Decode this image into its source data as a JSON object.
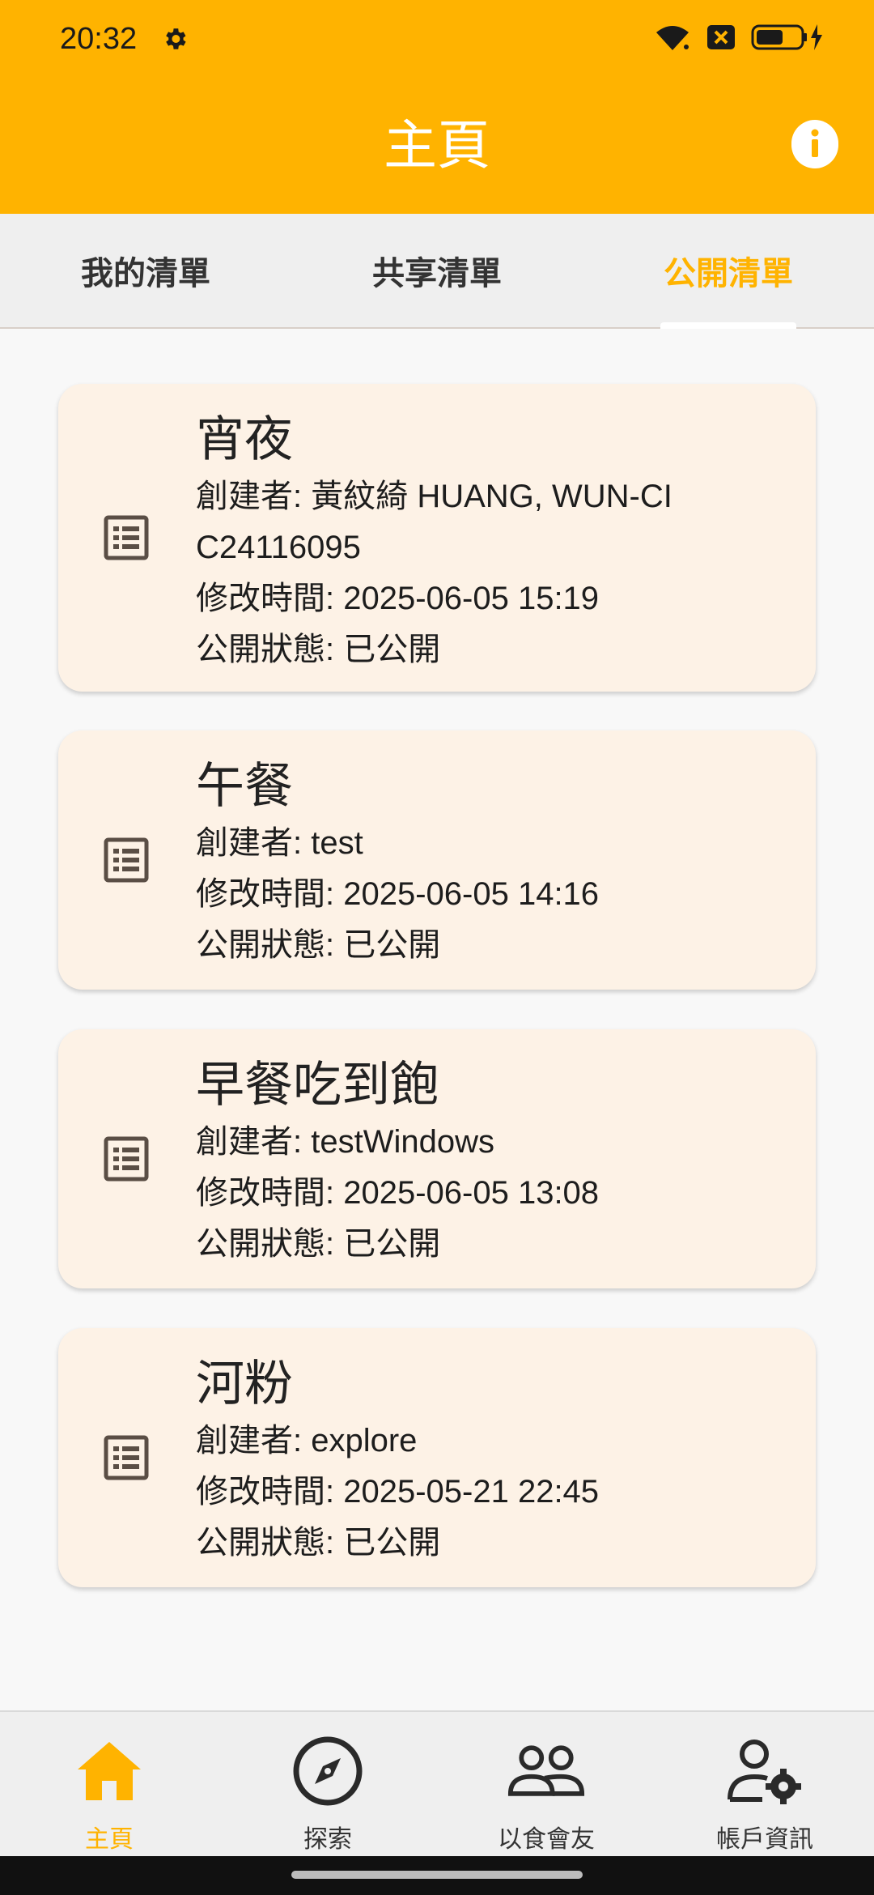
{
  "status_bar": {
    "time": "20:32"
  },
  "app_bar": {
    "title": "主頁"
  },
  "tabs": [
    {
      "label": "我的清單",
      "active": false
    },
    {
      "label": "共享清單",
      "active": false
    },
    {
      "label": "公開清單",
      "active": true
    }
  ],
  "cards": [
    {
      "title": "宵夜",
      "creator_line1": "創建者: 黃紋綺 HUANG, WUN-CI",
      "creator_line2": "C24116095",
      "modified": "修改時間: 2025-06-05 15:19",
      "status": "公開狀態: 已公開"
    },
    {
      "title": "午餐",
      "creator_line1": "創建者: test",
      "modified": "修改時間: 2025-06-05 14:16",
      "status": "公開狀態: 已公開"
    },
    {
      "title": "早餐吃到飽",
      "creator_line1": "創建者: testWindows",
      "modified": "修改時間: 2025-06-05 13:08",
      "status": "公開狀態: 已公開"
    },
    {
      "title": "河粉",
      "creator_line1": "創建者: explore",
      "modified": "修改時間: 2025-05-21 22:45",
      "status": "公開狀態: 已公開"
    }
  ],
  "bottom_nav": [
    {
      "label": "主頁",
      "icon": "home-icon",
      "active": true
    },
    {
      "label": "探索",
      "icon": "compass-icon",
      "active": false
    },
    {
      "label": "以食會友",
      "icon": "people-icon",
      "active": false
    },
    {
      "label": "帳戶資訊",
      "icon": "account-settings-icon",
      "active": false
    }
  ],
  "colors": {
    "accent": "#ffb300",
    "card_bg": "#fdf2e6",
    "icon": "#5a4e45"
  }
}
